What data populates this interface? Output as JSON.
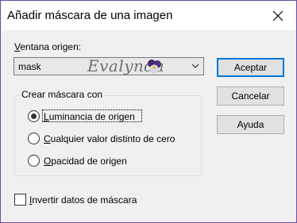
{
  "window": {
    "title": "Añadir máscara de una imagen",
    "border_color": "#6b4fa8"
  },
  "source": {
    "label_first": "V",
    "label_rest": "entana origen:",
    "selected": "mask",
    "dropdown_icon": "chevron-down-icon"
  },
  "watermark": {
    "text": "Evalynda",
    "icon": "flower-icon"
  },
  "group": {
    "title": "Crear máscara con",
    "options": [
      {
        "first": "L",
        "rest": "uminancia de origen",
        "selected": true
      },
      {
        "first": "C",
        "rest": "ualquier valor distinto de cero",
        "selected": false
      },
      {
        "first": "O",
        "rest": "pacidad de origen",
        "selected": false
      }
    ]
  },
  "invert": {
    "first": "I",
    "rest": "nvertir datos de máscara",
    "checked": false
  },
  "buttons": {
    "accept": "Aceptar",
    "cancel": "Cancelar",
    "help": "Ayuda",
    "accent": "#0078d7"
  }
}
